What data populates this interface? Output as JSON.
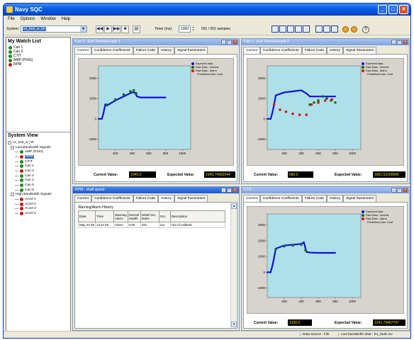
{
  "app": {
    "title": "Navy SQC"
  },
  "menu": [
    "File",
    "Options",
    "Window",
    "Help"
  ],
  "toolbar": {
    "system_label": "System:",
    "system_value": "ce_test_w_hh",
    "timer_label": "Timer (ms):",
    "timer_value": "1000",
    "samples": "001 / 001 samples",
    "help_glyph": "?"
  },
  "watch_list": {
    "title": "My Watch List",
    "items": [
      {
        "label": "Can 1",
        "status": "green"
      },
      {
        "label": "Can 2",
        "status": "green"
      },
      {
        "label": "CTIT",
        "status": "green"
      },
      {
        "label": "AMP (PSIG)",
        "status": "green"
      },
      {
        "label": "RPM",
        "status": "red"
      }
    ]
  },
  "system_view": {
    "title": "System View",
    "root": "ce_test_w_hh",
    "low_group": "Low Bandwidth Signals",
    "low_items": [
      {
        "label": "AMP (PSIG)",
        "status": "green"
      },
      {
        "label": "RPM",
        "status": "red",
        "selected": true
      },
      {
        "label": "CTIT",
        "status": "green"
      },
      {
        "label": "Can 1",
        "status": "green"
      },
      {
        "label": "Can 2",
        "status": "red"
      },
      {
        "label": "Can 3",
        "status": "green"
      },
      {
        "label": "Can 4",
        "status": "green"
      },
      {
        "label": "Can 5",
        "status": "green"
      },
      {
        "label": "Can 6",
        "status": "green"
      }
    ],
    "high_group": "High Bandwidth Signals",
    "high_items": [
      {
        "label": "Accel 1",
        "status": "red"
      },
      {
        "label": "Accel 2",
        "status": "red"
      },
      {
        "label": "Accel 3",
        "status": "red"
      },
      {
        "label": "Accel 4",
        "status": "red"
      }
    ]
  },
  "tabs": [
    "Current",
    "Confidence Coefficients",
    "Failure Code",
    "History",
    "Signal Parameters"
  ],
  "legend": [
    "Expected data",
    "Raw Data - Normal",
    "Raw Data - Alarm",
    "Predefined Alar. Limit"
  ],
  "colors": {
    "expected": "#1010e0",
    "normal": "#107010",
    "alarm": "#e01010",
    "plot_bg": "#aee0ea"
  },
  "windows": {
    "can1": {
      "title": "Can 1 - Exh Thermocouple 1",
      "current_label": "Current Value:",
      "current_value": "1040.0",
      "expected_label": "Expected Value:",
      "expected_value": "1049.74902344"
    },
    "can2": {
      "title": "Can 2 - Exh Thermocouple 2",
      "current_label": "Current Value:",
      "current_value": "960.0",
      "expected_label": "Expected Value:",
      "expected_value": "1001.53100586"
    },
    "rpm": {
      "title": "RPM - shaft speed",
      "history_title": "Warning/Alarm History",
      "columns": [
        "Date",
        "Time",
        "Warning Alarm",
        "Overall Health",
        "Initial Occ. Index",
        "Occ.",
        "Description"
      ],
      "rows": [
        [
          "May 23 06",
          "13:11:55",
          "Alarm",
          "0.80",
          "331",
          "111",
          "Out of calibrati"
        ]
      ]
    },
    "ctit": {
      "title": "CTIT",
      "current_label": "Current Value:",
      "current_value": "1230.0",
      "expected_label": "Expected Value:",
      "expected_value": "1241.79467797"
    }
  },
  "chart_data": [
    {
      "type": "scatter",
      "title": "Can 1 - Exh Thermocouple 1",
      "x_ticks": [
        200,
        400,
        600,
        800,
        1000
      ],
      "y_ticks": [
        2000,
        1000,
        0,
        -1000
      ],
      "xlim": [
        0,
        1100
      ],
      "ylim": [
        -1500,
        2600
      ],
      "series": [
        {
          "name": "Expected data",
          "x": [
            0,
            40,
            60,
            80,
            100,
            200,
            300,
            400,
            430,
            460,
            500,
            600,
            700,
            800
          ],
          "y": [
            0,
            0,
            300,
            700,
            650,
            900,
            1100,
            1300,
            1300,
            1100,
            1050,
            1050,
            1050,
            1050
          ]
        },
        {
          "name": "Raw Data - Normal",
          "x": [
            100,
            200,
            300,
            380,
            420,
            450
          ],
          "y": [
            700,
            950,
            1200,
            1350,
            1400,
            1250
          ]
        },
        {
          "name": "Raw Data - Alarm",
          "x": [],
          "y": []
        }
      ]
    },
    {
      "type": "scatter",
      "title": "Can 2 - Exh Thermocouple 2",
      "x_ticks": [
        200,
        400,
        600,
        800,
        1000
      ],
      "y_ticks": [
        2000,
        1000,
        0,
        -1000
      ],
      "xlim": [
        0,
        1100
      ],
      "ylim": [
        -1500,
        2600
      ],
      "series": [
        {
          "name": "Expected data",
          "x": [
            0,
            40,
            60,
            80,
            100,
            200,
            300,
            400,
            460,
            500,
            600,
            700,
            800
          ],
          "y": [
            0,
            0,
            300,
            700,
            1150,
            1300,
            1350,
            1400,
            1250,
            1100,
            1100,
            1100,
            1100
          ]
        },
        {
          "name": "Raw Data - Normal",
          "x": [
            500,
            550,
            600,
            650,
            700,
            750,
            800
          ],
          "y": [
            700,
            800,
            900,
            1100,
            1000,
            900,
            800
          ]
        },
        {
          "name": "Raw Data - Alarm",
          "x": [
            80,
            150,
            220,
            300,
            380,
            460,
            520,
            600,
            680,
            760
          ],
          "y": [
            700,
            450,
            350,
            250,
            200,
            200,
            700,
            800,
            900,
            950
          ]
        }
      ]
    },
    {
      "type": "scatter",
      "title": "CTIT",
      "x_ticks": [
        200,
        400,
        600,
        800,
        1000
      ],
      "y_ticks": [
        3000,
        2000,
        1000,
        0,
        -1000
      ],
      "xlim": [
        0,
        1100
      ],
      "ylim": [
        -1600,
        3700
      ],
      "series": [
        {
          "name": "Expected data",
          "x": [
            0,
            40,
            60,
            80,
            100,
            200,
            300,
            400,
            430,
            460,
            500,
            600,
            700,
            800
          ],
          "y": [
            0,
            0,
            400,
            900,
            1500,
            1700,
            1750,
            1800,
            1900,
            1300,
            1250,
            1230,
            1230,
            1230
          ]
        },
        {
          "name": "Raw Data - Normal",
          "x": [
            100,
            200,
            300,
            400,
            450
          ],
          "y": [
            1450,
            1650,
            1700,
            1750,
            1400
          ]
        },
        {
          "name": "Raw Data - Alarm",
          "x": [],
          "y": []
        }
      ]
    }
  ],
  "status": {
    "source": "Data source : File",
    "file": "Low bandwidth data : E1_fault.csv"
  }
}
